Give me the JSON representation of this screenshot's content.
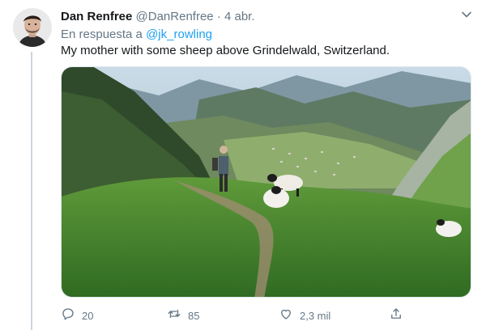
{
  "tweet": {
    "author_name": "Dan Renfree",
    "author_handle": "@DanRenfree",
    "separator": "·",
    "timestamp": "4 abr.",
    "reply_prefix": "En respuesta a",
    "reply_to": "@jk_rowling",
    "text": "My mother with some sheep above Grindelwald, Switzerland.",
    "media_description": "Photo of a woman standing on a grassy Alpine ridge with sheep, valley and mountains behind"
  },
  "actions": {
    "reply_count": "20",
    "retweet_count": "85",
    "like_count": "2,3 mil"
  },
  "colors": {
    "link": "#1da1f2",
    "muted": "#657786",
    "thread_line": "#ccd6dd"
  },
  "icons": [
    "avatar",
    "chevron-down-icon",
    "reply-icon",
    "retweet-icon",
    "like-icon",
    "share-icon"
  ]
}
